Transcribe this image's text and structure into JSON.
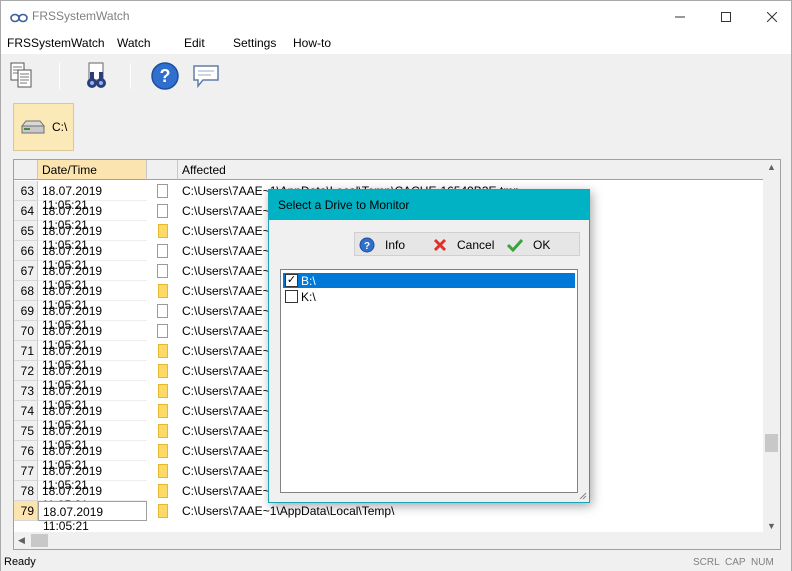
{
  "window": {
    "title": "FRSSystemWatch"
  },
  "menu": [
    "FRSSystemWatch",
    "Watch",
    "Edit",
    "Settings",
    "How-to"
  ],
  "toolbar": {
    "icons": [
      "copy-icon",
      "find-icon",
      "help-icon",
      "message-icon"
    ]
  },
  "drive": {
    "label": "C:\\"
  },
  "grid": {
    "columns": [
      "Date/Time",
      "",
      "Affected"
    ],
    "rows": [
      {
        "num": "63",
        "date": "18.07.2019 11:05:21",
        "type": "file",
        "affected": "C:\\Users\\7AAE~1\\AppData\\Local\\Temp\\CACHE-16549B3E.tmp"
      },
      {
        "num": "64",
        "date": "18.07.2019 11:05:21",
        "type": "file",
        "affected": "C:\\Users\\7AAE~1"
      },
      {
        "num": "65",
        "date": "18.07.2019 11:05:21",
        "type": "folder",
        "affected": "C:\\Users\\7AAE~1"
      },
      {
        "num": "66",
        "date": "18.07.2019 11:05:21",
        "type": "file",
        "affected": "C:\\Users\\7AAE~1"
      },
      {
        "num": "67",
        "date": "18.07.2019 11:05:21",
        "type": "file",
        "affected": "C:\\Users\\7AAE~1"
      },
      {
        "num": "68",
        "date": "18.07.2019 11:05:21",
        "type": "folder",
        "affected": "C:\\Users\\7AAE~1"
      },
      {
        "num": "69",
        "date": "18.07.2019 11:05:21",
        "type": "file",
        "affected": "C:\\Users\\7AAE~1"
      },
      {
        "num": "70",
        "date": "18.07.2019 11:05:21",
        "type": "file",
        "affected": "C:\\Users\\7AAE~1"
      },
      {
        "num": "71",
        "date": "18.07.2019 11:05:21",
        "type": "folder",
        "affected": "C:\\Users\\7AAE~1"
      },
      {
        "num": "72",
        "date": "18.07.2019 11:05:21",
        "type": "folder",
        "affected": "C:\\Users\\7AAE~1"
      },
      {
        "num": "73",
        "date": "18.07.2019 11:05:21",
        "type": "folder",
        "affected": "C:\\Users\\7AAE~1"
      },
      {
        "num": "74",
        "date": "18.07.2019 11:05:21",
        "type": "folder",
        "affected": "C:\\Users\\7AAE~1"
      },
      {
        "num": "75",
        "date": "18.07.2019 11:05:21",
        "type": "folder",
        "affected": "C:\\Users\\7AAE~1"
      },
      {
        "num": "76",
        "date": "18.07.2019 11:05:21",
        "type": "folder",
        "affected": "C:\\Users\\7AAE~1"
      },
      {
        "num": "77",
        "date": "18.07.2019 11:05:21",
        "type": "folder",
        "affected": "C:\\Users\\7AAE~1"
      },
      {
        "num": "78",
        "date": "18.07.2019 11:05:21",
        "type": "folder",
        "affected": "C:\\Users\\7AAE~1"
      },
      {
        "num": "79",
        "date": "18.07.2019 11:05:21",
        "type": "folder",
        "affected": "C:\\Users\\7AAE~1\\AppData\\Local\\Temp\\"
      }
    ]
  },
  "status": {
    "text": "Ready",
    "indicators": [
      "SCRL",
      "CAP",
      "NUM"
    ]
  },
  "dialog": {
    "title": "Select a Drive to Monitor",
    "buttons": {
      "info": "Info",
      "cancel": "Cancel",
      "ok": "OK"
    },
    "drives": [
      {
        "label": "B:\\",
        "checked": true,
        "selected": true
      },
      {
        "label": "K:\\",
        "checked": false,
        "selected": false
      }
    ]
  },
  "colors": {
    "accent": "#00b2c3",
    "selection": "#0078d7",
    "highlight": "#fce4b0"
  }
}
